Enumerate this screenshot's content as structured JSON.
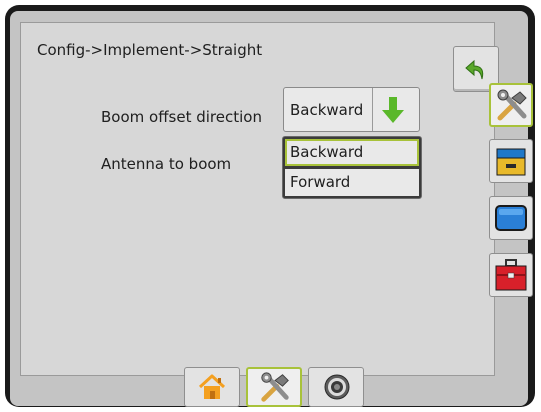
{
  "header": {
    "breadcrumb": "Config->Implement->Straight"
  },
  "form": {
    "boom_offset_direction": {
      "label": "Boom offset direction",
      "value": "Backward"
    },
    "antenna_to_boom": {
      "label": "Antenna to boom"
    }
  },
  "dropdown": {
    "options": [
      {
        "label": "Backward",
        "selected": true
      },
      {
        "label": "Forward",
        "selected": false
      }
    ]
  },
  "side_tabs": [
    {
      "icon": "tools-icon",
      "active": true
    },
    {
      "icon": "console-icon",
      "active": false
    },
    {
      "icon": "display-icon",
      "active": false
    },
    {
      "icon": "toolbox-icon",
      "active": false
    }
  ],
  "bottom_tabs": [
    {
      "icon": "home-icon",
      "active": false
    },
    {
      "icon": "tools-icon",
      "active": true
    },
    {
      "icon": "guidance-icon",
      "active": false
    }
  ],
  "colors": {
    "accent_green": "#a8c23a",
    "back_arrow_green": "#5aa82a",
    "toolbox_red": "#d8202a",
    "display_blue": "#2a7fd6",
    "console_yellow": "#e8b92a"
  }
}
